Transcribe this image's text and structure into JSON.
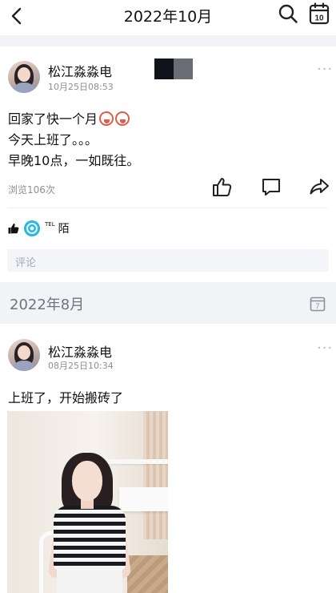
{
  "header": {
    "title": "2022年10月",
    "back_icon": "chevron-left-icon",
    "search_icon": "search-icon",
    "calendar_icon": "calendar-icon",
    "calendar_day": "10"
  },
  "posts": [
    {
      "author": "松江淼淼电",
      "time": "10月25日08:53",
      "lines": [
        "回家了快一个月",
        "今天上班了。。。",
        "早晚10点，一如既往。"
      ],
      "views": "浏览106次",
      "actions": [
        "like-icon",
        "comment-icon",
        "share-icon"
      ],
      "liker_tag": "TEL",
      "liker_name": "陌",
      "comment_placeholder": "评论"
    },
    {
      "author": "松江淼淼电",
      "time": "08月25日10:34",
      "lines": [
        "上班了，开始搬砖了"
      ]
    }
  ],
  "section": {
    "label": "2022年8月",
    "calendar_day": "7"
  }
}
